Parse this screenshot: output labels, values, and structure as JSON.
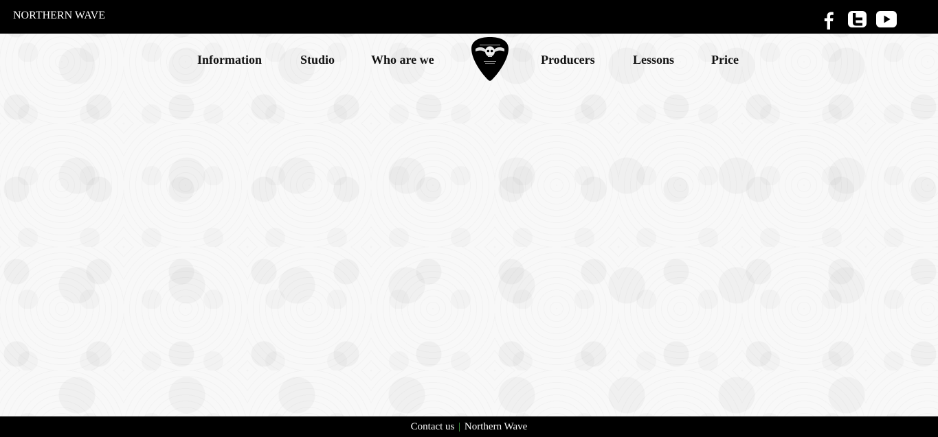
{
  "header": {
    "brand": "NORTHERN WAVE",
    "social": [
      {
        "name": "facebook-icon",
        "color": "#ffffff"
      },
      {
        "name": "twitter-icon",
        "color": "#ffffff"
      },
      {
        "name": "youtube-icon",
        "color": "#ffffff"
      }
    ]
  },
  "nav": {
    "left": [
      "Information",
      "Studio",
      "Who are we"
    ],
    "right": [
      "Producers",
      "Lessons",
      "Price"
    ],
    "logo_icon": "guitar-pick-skull-logo"
  },
  "footer": {
    "contact": "Contact us",
    "separator": "|",
    "name": "Northern Wave",
    "separator_color": "#4caf50"
  },
  "colors": {
    "bar": "#000000",
    "background": "#f8f8f8",
    "nav_text": "#111111"
  }
}
